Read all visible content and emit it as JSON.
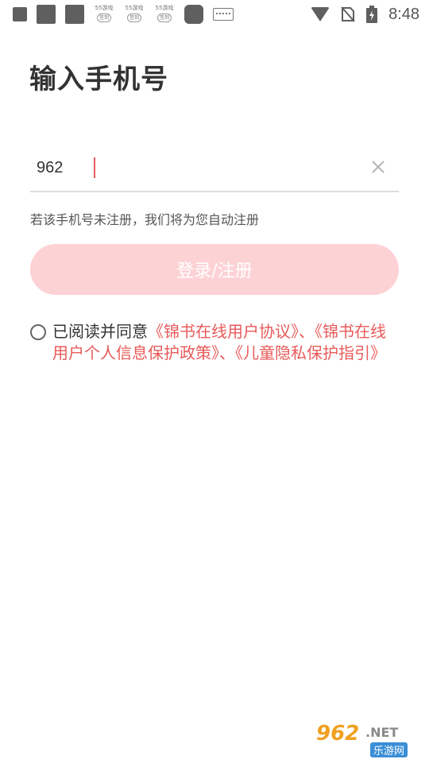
{
  "status_bar": {
    "time": "8:48",
    "notification_icons": [
      "app-icon",
      "app-icon",
      "app-icon",
      "55-app-icon",
      "55-app-icon",
      "55-app-icon",
      "app-icon",
      "keyboard-icon"
    ],
    "mini_app_label_1": "55游戏",
    "mini_app_label_2": "签到"
  },
  "page": {
    "title": "输入手机号"
  },
  "phone_input": {
    "value": "962",
    "clear_icon": "close-icon"
  },
  "hint": "若该手机号未注册，我们将为您自动注册",
  "login_button": {
    "label": "登录/注册",
    "bg_color": "#fdd2d5"
  },
  "agreement": {
    "prefix": "已阅读并同意",
    "link_1": "《锦书在线用户协议》",
    "sep_1": "、",
    "link_2": "《锦书在线用户个人信息保护政策》",
    "sep_2": "、",
    "link_3": "《儿童隐私保护指引》",
    "link_color": "#e85a5a"
  },
  "watermark": {
    "logo": "962",
    "net": ".NET",
    "sub": "乐游网"
  }
}
